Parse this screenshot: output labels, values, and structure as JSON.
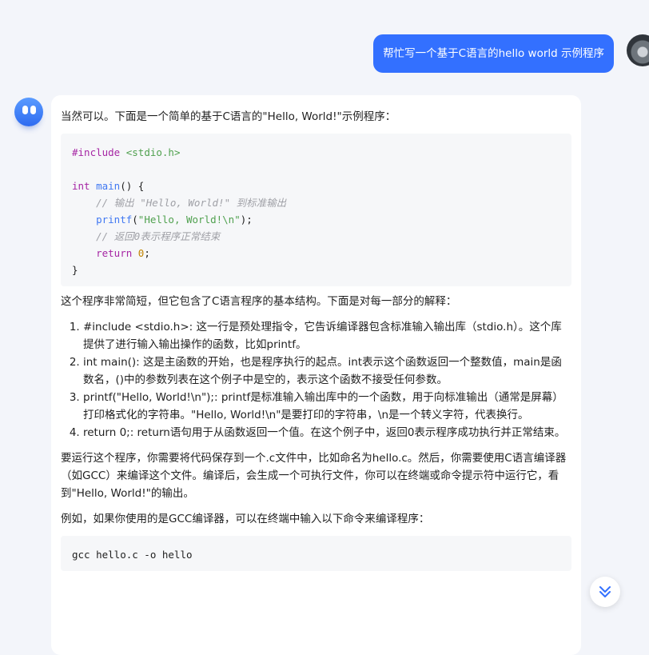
{
  "user_message": "帮忙写一个基于C语言的hello world 示例程序",
  "reply": {
    "intro": "当然可以。下面是一个简单的基于C语言的\"Hello, World!\"示例程序：",
    "code_lines": {
      "l1_pp": "#include",
      "l1_inc": " <stdio.h>",
      "l3_kw": "int",
      "l3_fn": " main",
      "l3_rest": "() {",
      "l4_cm": "    // 输出 \"Hello, World!\" 到标准输出",
      "l5_fn": "    printf",
      "l5_open": "(",
      "l5_str": "\"Hello, World!\\n\"",
      "l5_close": ");",
      "l6_cm": "    // 返回0表示程序正常结束",
      "l7_kw": "    return",
      "l7_sp": " ",
      "l7_num": "0",
      "l7_semi": ";",
      "l8": "}"
    },
    "para2": "这个程序非常简短，但它包含了C语言程序的基本结构。下面是对每一部分的解释：",
    "explanations": [
      "#include <stdio.h>: 这一行是预处理指令，它告诉编译器包含标准输入输出库（stdio.h）。这个库提供了进行输入输出操作的函数，比如printf。",
      "int main(): 这是主函数的开始，也是程序执行的起点。int表示这个函数返回一个整数值，main是函数名，()中的参数列表在这个例子中是空的，表示这个函数不接受任何参数。",
      "printf(\"Hello, World!\\n\");: printf是标准输入输出库中的一个函数，用于向标准输出（通常是屏幕）打印格式化的字符串。\"Hello, World!\\n\"是要打印的字符串，\\n是一个转义字符，代表换行。",
      "return 0;: return语句用于从函数返回一个值。在这个例子中，返回0表示程序成功执行并正常结束。"
    ],
    "para3": "要运行这个程序，你需要将代码保存到一个.c文件中，比如命名为hello.c。然后，你需要使用C语言编译器（如GCC）来编译这个文件。编译后，会生成一个可执行文件，你可以在终端或命令提示符中运行它，看到\"Hello, World!\"的输出。",
    "para4": "例如，如果你使用的是GCC编译器，可以在终端中输入以下命令来编译程序：",
    "command": "gcc hello.c -o hello"
  },
  "colors": {
    "accent": "#3370ff",
    "background": "#f3f5fa"
  },
  "icons": {
    "scroll": "double-chevron-down-icon"
  }
}
